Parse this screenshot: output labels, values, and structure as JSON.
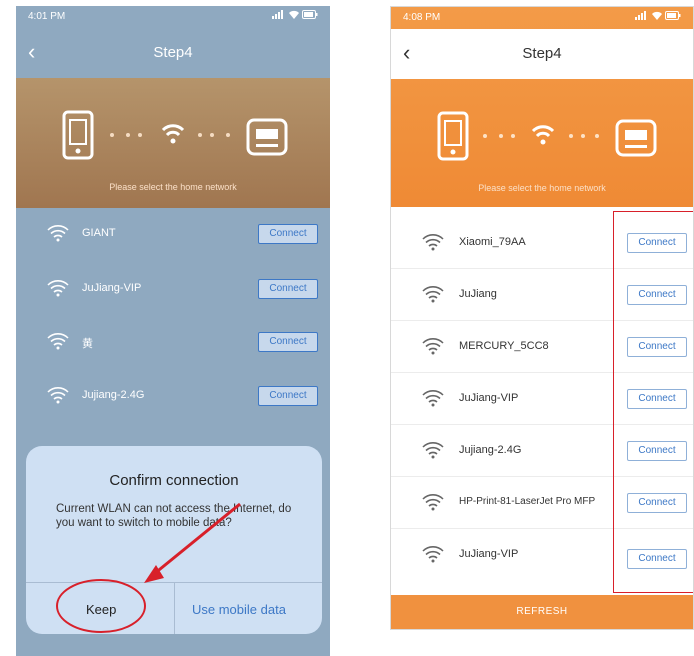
{
  "left_screen": {
    "status_time": "4:01 PM",
    "title": "Step4",
    "banner_caption": "Please select the home network",
    "networks": [
      {
        "ssid": "GIANT",
        "button": "Connect"
      },
      {
        "ssid": "JuJiang-VIP",
        "button": "Connect"
      },
      {
        "ssid": "黄",
        "button": "Connect"
      },
      {
        "ssid": "Jujiang-2.4G",
        "button": "Connect"
      }
    ],
    "dialog": {
      "title": "Confirm connection",
      "message": "Current WLAN can not access the Internet, do you want to switch to mobile data?",
      "keep": "Keep",
      "use_mobile": "Use mobile data"
    }
  },
  "right_screen": {
    "status_time": "4:08 PM",
    "title": "Step4",
    "banner_caption": "Please select the home network",
    "networks": [
      {
        "ssid": "Xiaomi_79AA",
        "button": "Connect"
      },
      {
        "ssid": "JuJiang",
        "button": "Connect"
      },
      {
        "ssid": "MERCURY_5CC8",
        "button": "Connect"
      },
      {
        "ssid": "JuJiang-VIP",
        "button": "Connect"
      },
      {
        "ssid": "Jujiang-2.4G",
        "button": "Connect"
      },
      {
        "ssid": "HP-Print-81-LaserJet Pro MFP",
        "button": "Connect"
      },
      {
        "ssid": "JuJiang-VIP",
        "button": "Connect"
      }
    ],
    "refresh": "REFRESH"
  },
  "colors": {
    "left_background": "#8fa9c0",
    "right_banner": "#f0913f",
    "accent_blue": "#3d78c6",
    "annotation_red": "#d8202a"
  },
  "icons": [
    "back-icon",
    "wifi-icon",
    "phone-icon",
    "router-icon",
    "signal-icon",
    "battery-icon"
  ]
}
